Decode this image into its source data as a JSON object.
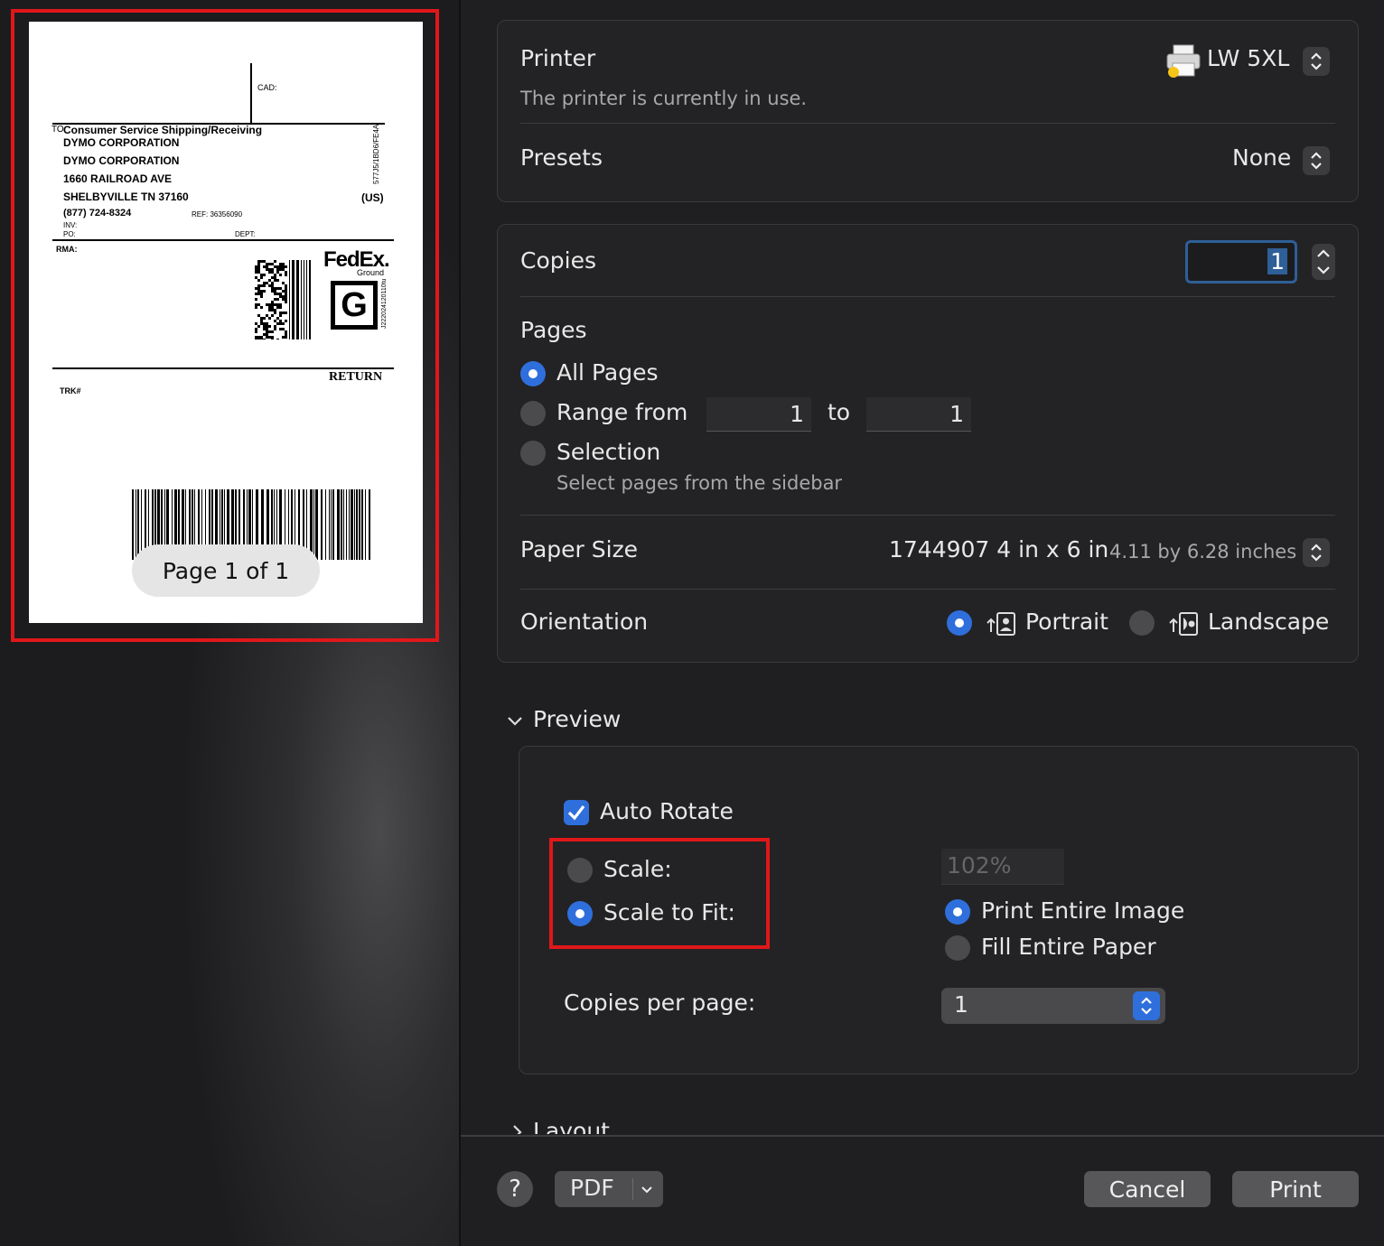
{
  "sidebar": {
    "page_indicator": "Page 1 of 1",
    "label": {
      "cad": "CAD:",
      "to": "TO",
      "recipient_attention": "Consumer Service Shipping/Receiving",
      "company_1": "DYMO CORPORATION",
      "company_2": "DYMO CORPORATION",
      "street": "1660 RAILROAD AVE",
      "city": "SHELBYVILLE TN 37160",
      "phone": "(877) 724-8324",
      "ref": "REF: 36356090",
      "country": "(US)",
      "inv": "INV:",
      "po": "PO:",
      "dept": "DEPT:",
      "rma": "RMA:",
      "side_code": "577J5/1BD6/FE4A",
      "carrier_logo": "FedEx.",
      "service": "Ground",
      "service_letter": "G",
      "vertical_code": "J222024120110tu",
      "return_text": "RETURN",
      "trk": "TRK#"
    }
  },
  "printer": {
    "label": "Printer",
    "value": "LW 5XL",
    "status": "The printer is currently in use."
  },
  "presets": {
    "label": "Presets",
    "value": "None"
  },
  "copies": {
    "label": "Copies",
    "value": "1"
  },
  "pages": {
    "label": "Pages",
    "all": "All Pages",
    "range": "Range from",
    "range_from": "1",
    "to": "to",
    "range_to": "1",
    "selection": "Selection",
    "selection_hint": "Select pages from the sidebar"
  },
  "paper_size": {
    "label": "Paper Size",
    "value": "1744907 4 in x 6 in",
    "dimensions": "4.11 by 6.28 inches"
  },
  "orientation": {
    "label": "Orientation",
    "portrait": "Portrait",
    "landscape": "Landscape"
  },
  "preview": {
    "header": "Preview",
    "auto_rotate": "Auto Rotate",
    "scale": "Scale:",
    "scale_value": "102%",
    "scale_to_fit": "Scale to Fit:",
    "print_entire_image": "Print Entire Image",
    "fill_entire_paper": "Fill Entire Paper",
    "copies_per_page_label": "Copies per page:",
    "copies_per_page_value": "1"
  },
  "layout_header": "Layout",
  "footer": {
    "help": "?",
    "pdf": "PDF",
    "cancel": "Cancel",
    "print": "Print"
  },
  "colors": {
    "accent": "#2f6fdc",
    "highlight": "#e0171a"
  }
}
